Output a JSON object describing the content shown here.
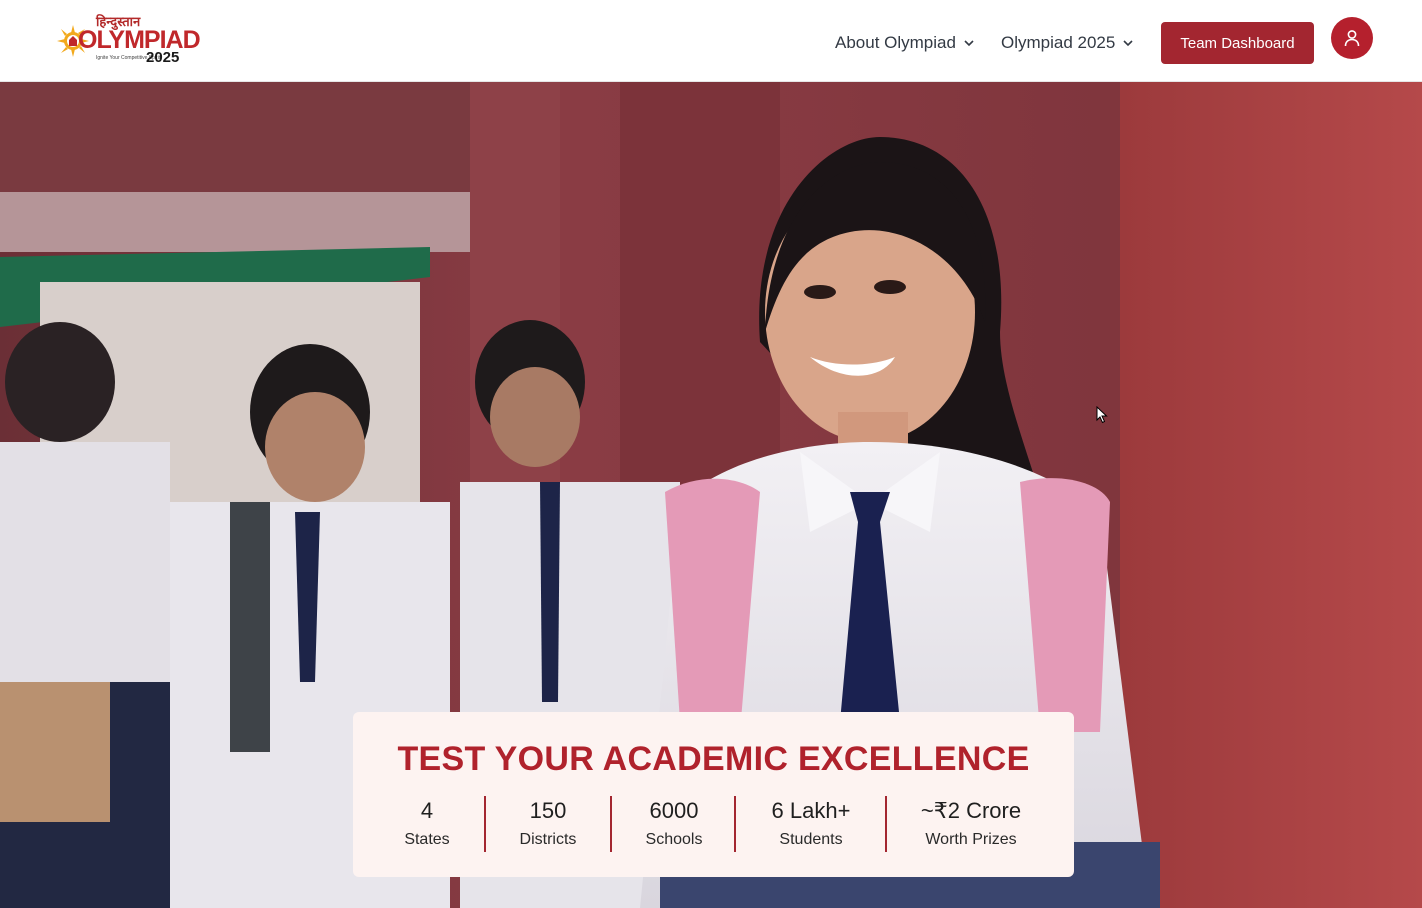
{
  "header": {
    "logo": {
      "hindi_text": "हिन्दुस्तान",
      "main_text": "OLYMPIAD",
      "tagline": "Ignite Your Competitive Spirit",
      "year": "2025"
    },
    "nav": [
      {
        "label": "About Olympiad",
        "icon": "chevron-down-icon"
      },
      {
        "label": "Olympiad 2025",
        "icon": "chevron-down-icon"
      }
    ],
    "team_button": "Team Dashboard",
    "user_icon": "user-icon"
  },
  "hero": {
    "image": "students-in-school-uniform-photo",
    "card": {
      "title": "TEST YOUR ACADEMIC EXCELLENCE",
      "stats": [
        {
          "value": "4",
          "label": "States"
        },
        {
          "value": "150",
          "label": "Districts"
        },
        {
          "value": "6000",
          "label": "Schools"
        },
        {
          "value": "6 Lakh+",
          "label": "Students"
        },
        {
          "value": "~₹2 Crore",
          "label": "Worth Prizes"
        }
      ]
    }
  },
  "colors": {
    "brand_red": "#a32630",
    "title_red": "#b0222c",
    "card_bg": "#fdf3f1",
    "nav_text": "#333a44"
  }
}
